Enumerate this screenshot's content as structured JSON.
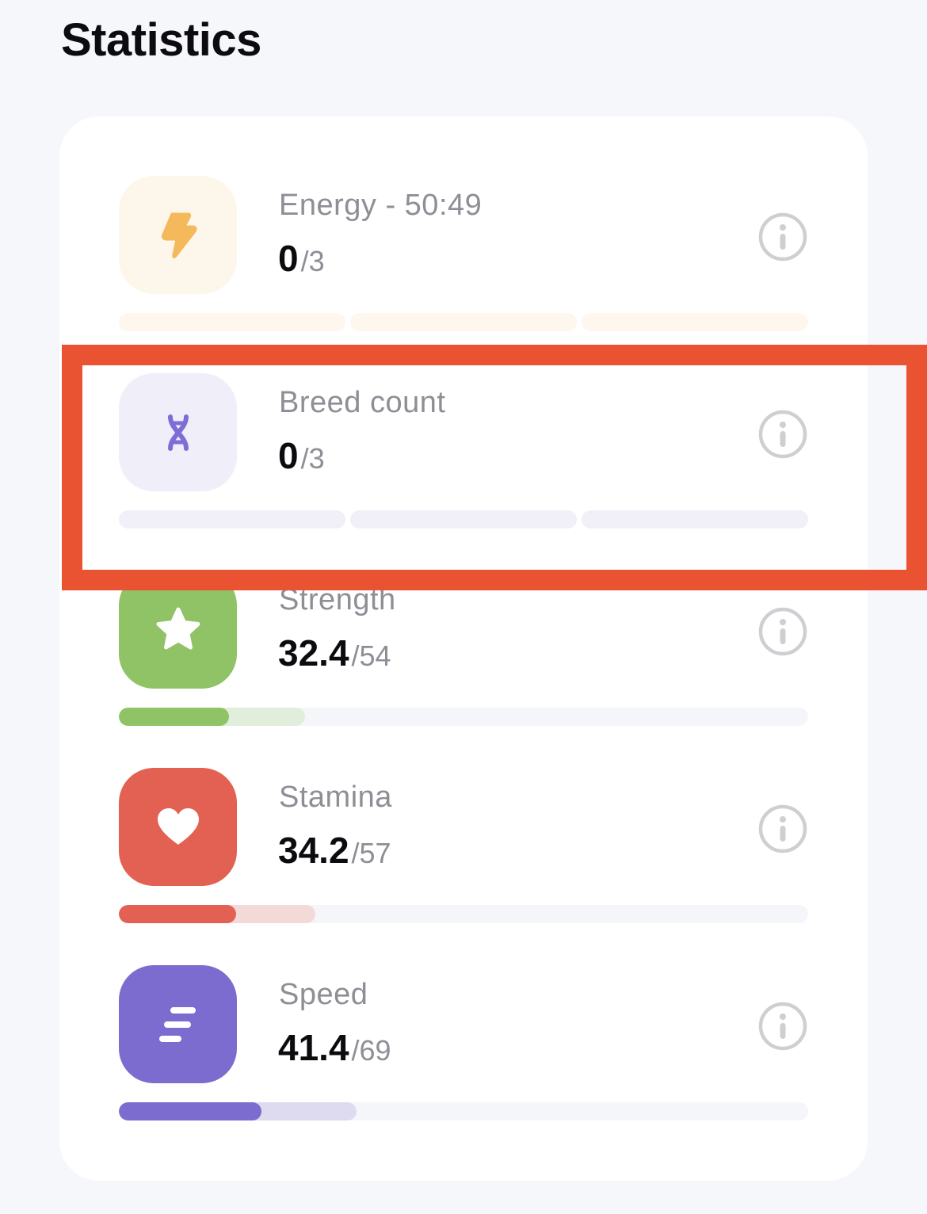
{
  "header": {
    "title": "Statistics"
  },
  "stats": [
    {
      "id": "energy",
      "label": "Energy - 50:49",
      "value": "0",
      "max": "/3",
      "icon": "lightning-icon",
      "icon_color": "#f4b95a",
      "tile_color": "#fdf6eb",
      "bar_type": "segmented",
      "segments": 3,
      "filled_segments": 0,
      "segment_color": "#fdf7ee"
    },
    {
      "id": "breed-count",
      "label": "Breed count",
      "value": "0",
      "max": "/3",
      "icon": "dna-icon",
      "icon_color": "#7f6cd6",
      "tile_color": "#f0eef9",
      "bar_type": "segmented",
      "segments": 3,
      "filled_segments": 0,
      "segment_color": "#f1f0f9"
    },
    {
      "id": "strength",
      "label": "Strength",
      "value": "32.4",
      "max": "/54",
      "icon": "star-icon",
      "icon_color": "#ffffff",
      "tile_color": "#90c266",
      "bar_type": "progress",
      "fill_fraction": 0.16,
      "secondary_fraction": 0.27,
      "fill_color": "#90c266",
      "secondary_color": "#e1eedb"
    },
    {
      "id": "stamina",
      "label": "Stamina",
      "value": "34.2",
      "max": "/57",
      "icon": "heart-icon",
      "icon_color": "#ffffff",
      "tile_color": "#e26153",
      "bar_type": "progress",
      "fill_fraction": 0.17,
      "secondary_fraction": 0.285,
      "fill_color": "#e26153",
      "secondary_color": "#f4d9d9"
    },
    {
      "id": "speed",
      "label": "Speed",
      "value": "41.4",
      "max": "/69",
      "icon": "speed-lines-icon",
      "icon_color": "#ffffff",
      "tile_color": "#7d6ccf",
      "bar_type": "progress",
      "fill_fraction": 0.207,
      "secondary_fraction": 0.345,
      "fill_color": "#7d6ccf",
      "secondary_color": "#dedbf1"
    }
  ],
  "highlight": {
    "target": "breed-count",
    "color": "#ea5331"
  }
}
